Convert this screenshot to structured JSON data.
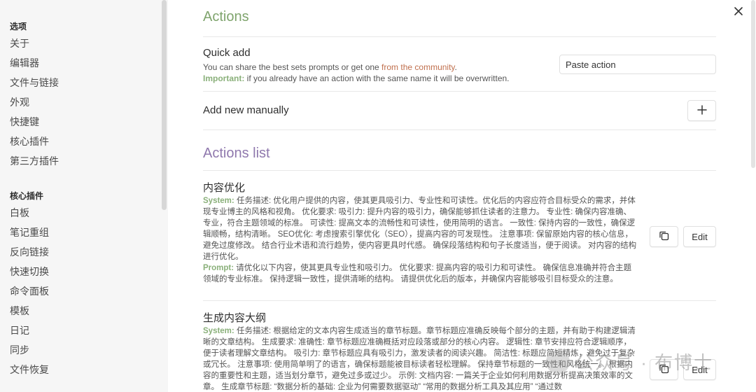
{
  "sidebar": {
    "section1": "选项",
    "options": [
      "关于",
      "编辑器",
      "文件与链接",
      "外观",
      "快捷键",
      "核心插件",
      "第三方插件"
    ],
    "section2": "核心插件",
    "plugins": [
      "白板",
      "笔记重组",
      "反向链接",
      "快速切换",
      "命令面板",
      "模板",
      "日记",
      "同步",
      "文件恢复"
    ]
  },
  "main": {
    "actions_title": "Actions",
    "quick_add": {
      "name": "Quick add",
      "desc_before": "You can share the best sets prompts or get one ",
      "desc_link": "from the community",
      "desc_after": ".",
      "important_label": "Important:",
      "important_text": " if you already have an action with the same name it will be overwritten.",
      "placeholder": "Paste action"
    },
    "add_new": {
      "name": "Add new manually",
      "button": "+"
    },
    "list_title": "Actions list",
    "actions": [
      {
        "name": "内容优化",
        "system_label": "System:",
        "system_text": " 任务描述: 优化用户提供的内容，使其更具吸引力、专业性和可读性。优化后的内容应符合目标受众的需求，并体现专业博主的风格和视角。 优化要求: 吸引力: 提升内容的吸引力，确保能够抓住读者的注意力。 专业性: 确保内容准确、专业，符合主题领域的标准。 可读性: 提高文本的流畅性和可读性，使用简明的语言。 一致性: 保持内容的一致性，确保逻辑顺畅，结构清晰。 SEO优化: 考虑搜索引擎优化（SEO），提高内容的可发现性。 注意事项: 保留原始内容的核心信息，避免过度修改。 结合行业术语和流行趋势，使内容更具时代感。 确保段落结构和句子长度适当，便于阅读。 对内容的结构进行优化。",
        "prompt_label": "Prompt:",
        "prompt_text": " 请优化以下内容，使其更具专业性和吸引力。 优化要求: 提高内容的吸引力和可读性。 确保信息准确并符合主题领域的专业标准。 保持逻辑一致性，提供清晰的结构。 请提供优化后的版本，并确保内容能够吸引目标受众的注意。",
        "edit_label": "Edit"
      },
      {
        "name": "生成内容大纲",
        "system_label": "System:",
        "system_text": " 任务描述: 根据给定的文本内容生成适当的章节标题。章节标题应准确反映每个部分的主题，并有助于构建逻辑清晰的文章结构。 生成要求: 准确性: 章节标题应准确概括对应段落或部分的核心内容。 逻辑性: 章节安排应符合逻辑顺序，便于读者理解文章结构。 吸引力: 章节标题应具有吸引力，激发读者的阅读兴趣。 简洁性: 标题应简短精炼，避免过于复杂或冗长。 注意事项: 使用简单明了的语言，确保标题能被目标读者轻松理解。 保持章节标题的一致性和风格统一。 根据内容的重要性和主题，适当划分章节，避免过多或过少。 示例: 文档内容: 一篇关于企业如何利用数据分析提高决策效率的文章。 生成章节标题: “数据分析的基础: 企业为何需要数据驱动” “常用的数据分析工具及其应用” “通过数",
        "edit_label": "Edit"
      }
    ]
  },
  "watermark": "公众号 · 布博士",
  "icons": {
    "close": "close-icon",
    "copy": "copy-icon",
    "plus": "plus-icon"
  }
}
